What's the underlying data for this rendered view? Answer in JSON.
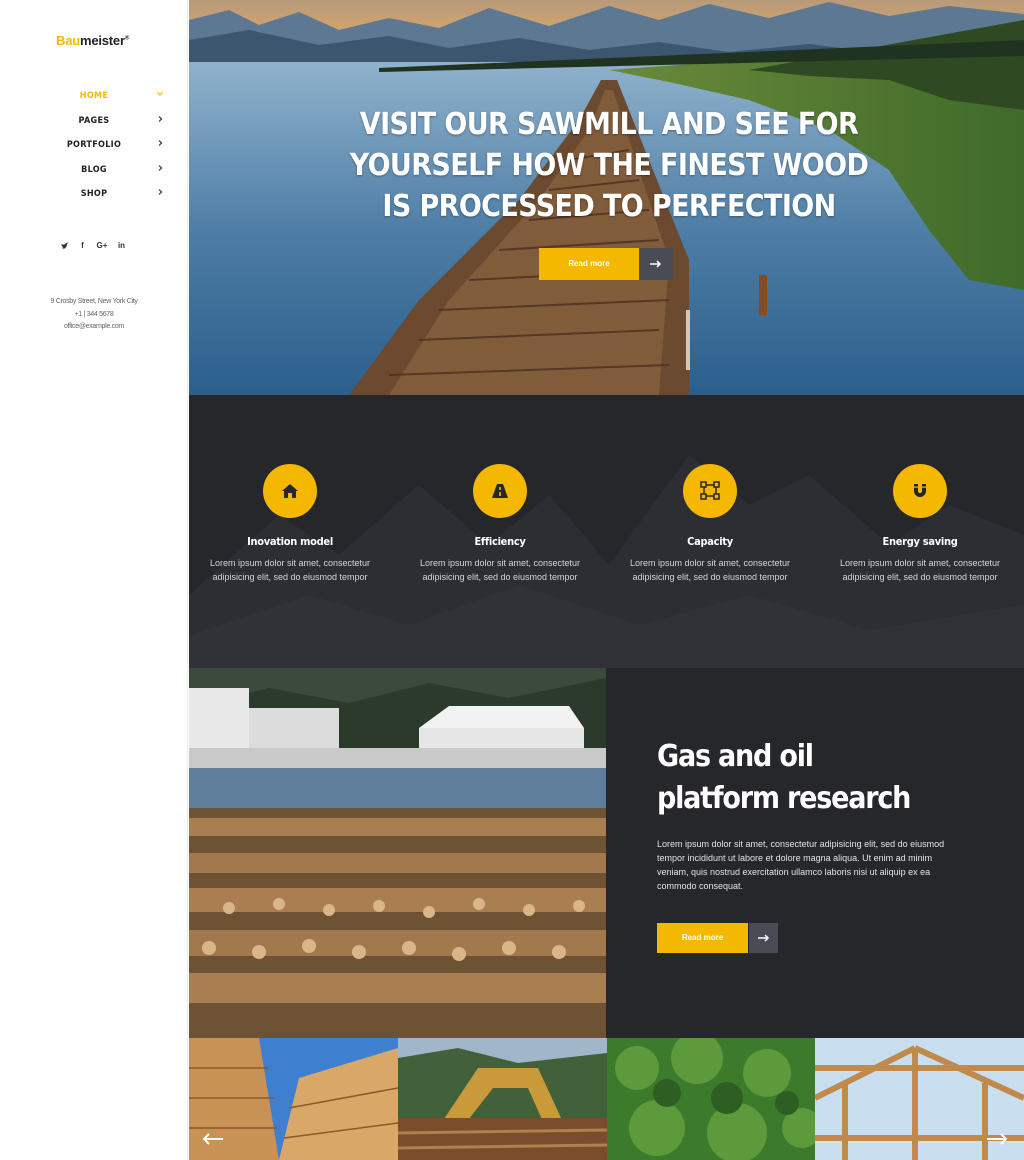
{
  "brand": {
    "prefix": "Bau",
    "suffix": "meister",
    "mark": "®"
  },
  "nav": {
    "items": [
      {
        "label": "HOME",
        "active": true,
        "chevron": "chevron-down-icon"
      },
      {
        "label": "PAGES",
        "active": false,
        "chevron": "chevron-right-icon"
      },
      {
        "label": "PORTFOLIO",
        "active": false,
        "chevron": "chevron-right-icon"
      },
      {
        "label": "BLOG",
        "active": false,
        "chevron": "chevron-right-icon"
      },
      {
        "label": "SHOP",
        "active": false,
        "chevron": "chevron-right-icon"
      }
    ]
  },
  "social": {
    "twitter": "🐦",
    "facebook": "f",
    "google": "G+",
    "linkedin": "in"
  },
  "contact": {
    "address": "9 Crosby Street, New York City",
    "phone": "+1 | 344 5678",
    "email": "office@example.com"
  },
  "hero": {
    "title": "VISIT OUR SAWMILL AND SEE FOR YOURSELF HOW THE FINEST WOOD IS PROCESSED TO PERFECTION",
    "button_label": "Read more",
    "arrow_icon": "arrow-right-icon"
  },
  "features": [
    {
      "icon": "home-icon",
      "title": "Inovation model",
      "text": "Lorem ipsum dolor sit amet, consectetur adipisicing elit, sed do eiusmod tempor"
    },
    {
      "icon": "road-icon",
      "title": "Efficiency",
      "text": "Lorem ipsum dolor sit amet, consectetur adipisicing elit, sed do eiusmod tempor"
    },
    {
      "icon": "nodes-icon",
      "title": "Capacity",
      "text": "Lorem ipsum dolor sit amet, consectetur adipisicing elit, sed do eiusmod tempor"
    },
    {
      "icon": "magnet-icon",
      "title": "Energy saving",
      "text": "Lorem ipsum dolor sit amet, consectetur adipisicing elit, sed do eiusmod tempor"
    }
  ],
  "research": {
    "title_line1": "Gas and oil",
    "title_line2": "platform research",
    "text": "Lorem ipsum dolor sit amet, consectetur adipisicing elit, sed do eiusmod tempor incididunt ut labore et dolore magna aliqua. Ut enim ad minim veniam, quis nostrud exercitation ullamco laboris nisi ut aliquip ex ea commodo consequat.",
    "button_label": "Read more"
  },
  "colors": {
    "accent": "#f5b800",
    "dark": "#26272b",
    "arrow_bg": "#4a4c55"
  }
}
